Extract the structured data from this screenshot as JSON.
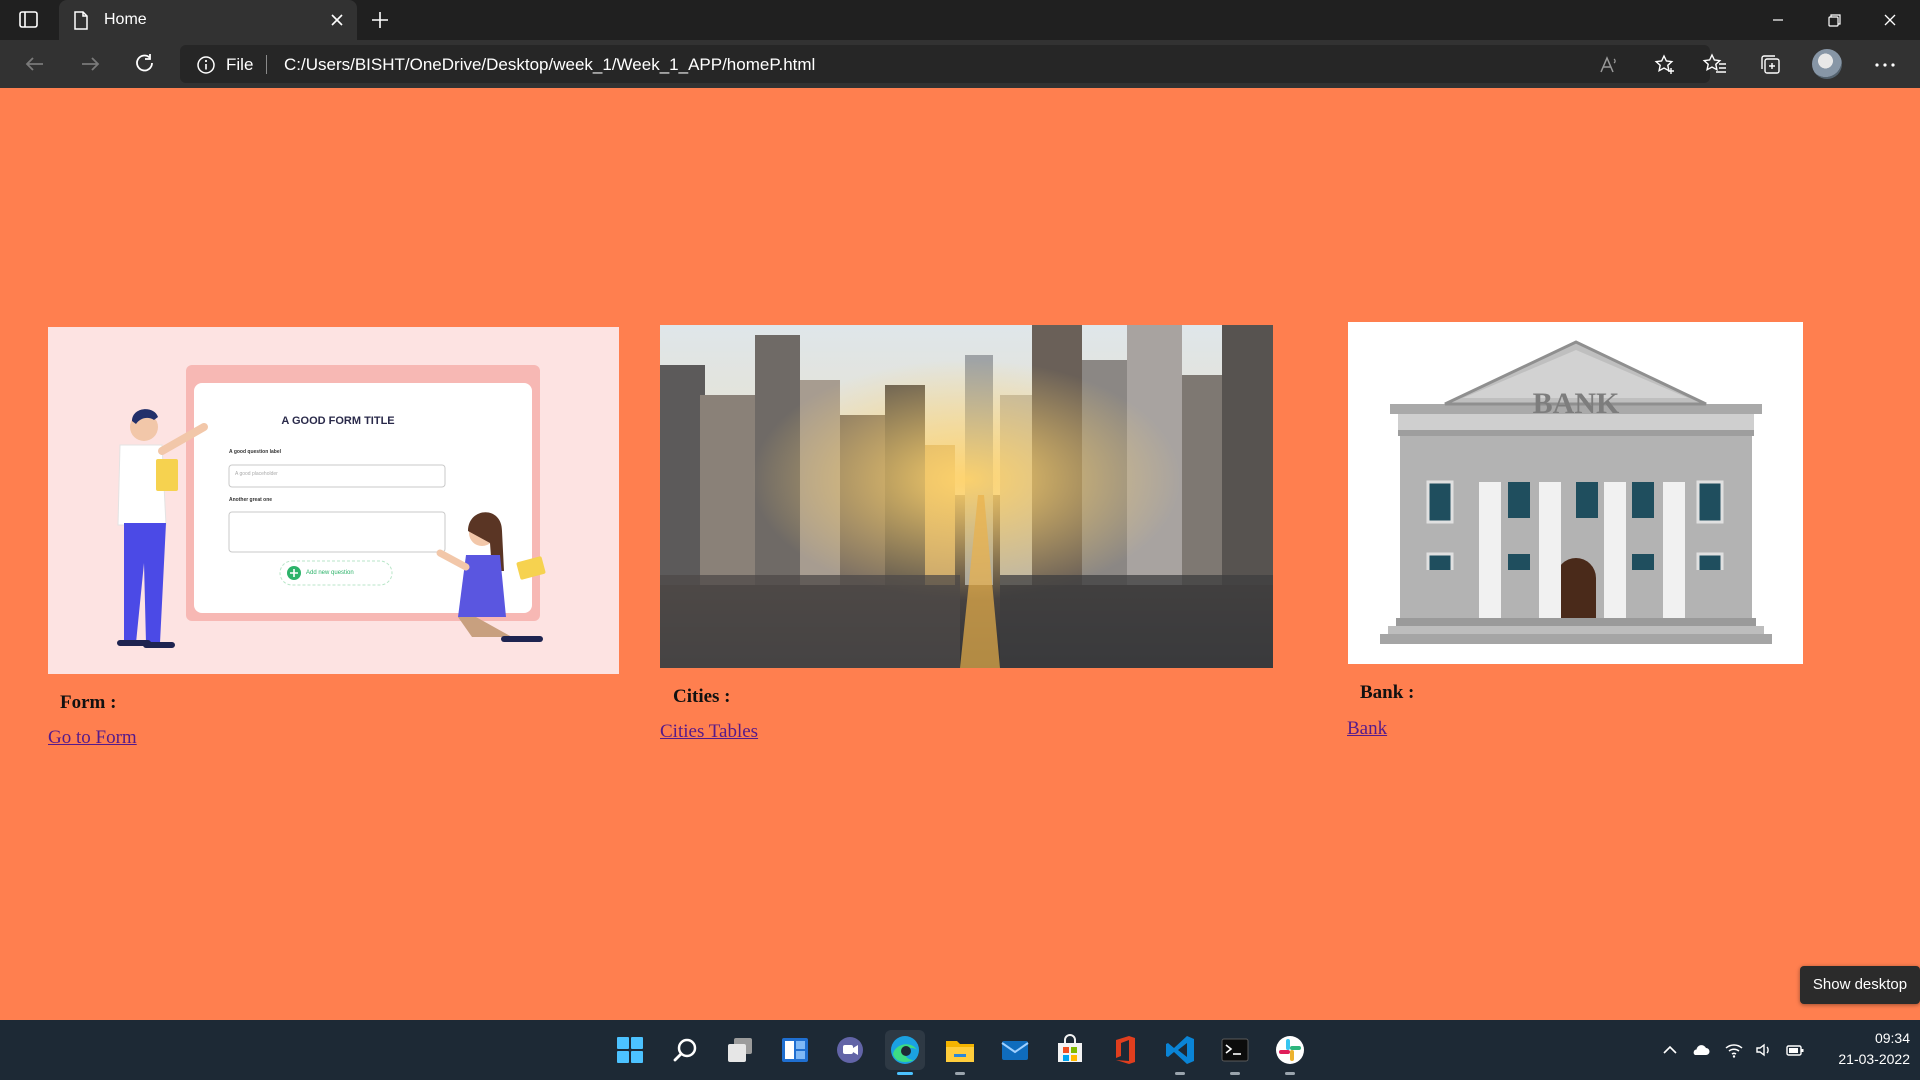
{
  "browser": {
    "tab_title": "Home",
    "address_scheme": "File",
    "url": "C:/Users/BISHT/OneDrive/Desktop/week_1/Week_1_APP/homeP.html"
  },
  "cards": [
    {
      "label": "Form :",
      "link_text": "Go to Form",
      "image": "form-illustration",
      "image_text": {
        "title": "A GOOD FORM TITLE",
        "q1": "A good question label",
        "q1_placeholder": "A good placeholder",
        "q2": "Another great one",
        "add_button": "Add new question"
      }
    },
    {
      "label": "Cities :",
      "link_text": "Cities Tables",
      "image": "city-skyline-photo"
    },
    {
      "label": "Bank :",
      "link_text": "Bank",
      "image": "bank-building-illustration",
      "image_text": {
        "sign": "BANK"
      }
    }
  ],
  "taskbar": {
    "apps": [
      "start",
      "search",
      "task-view",
      "widgets",
      "chat",
      "edge",
      "file-explorer",
      "mail",
      "store",
      "office",
      "vs-code",
      "terminal",
      "slack"
    ],
    "active_app": "edge",
    "time": "09:34",
    "date": "21-03-2022"
  },
  "tooltip": "Show desktop",
  "colors": {
    "page_background": "#ff7f4f",
    "link": "#551a8b",
    "taskbar": "#1d2935"
  }
}
